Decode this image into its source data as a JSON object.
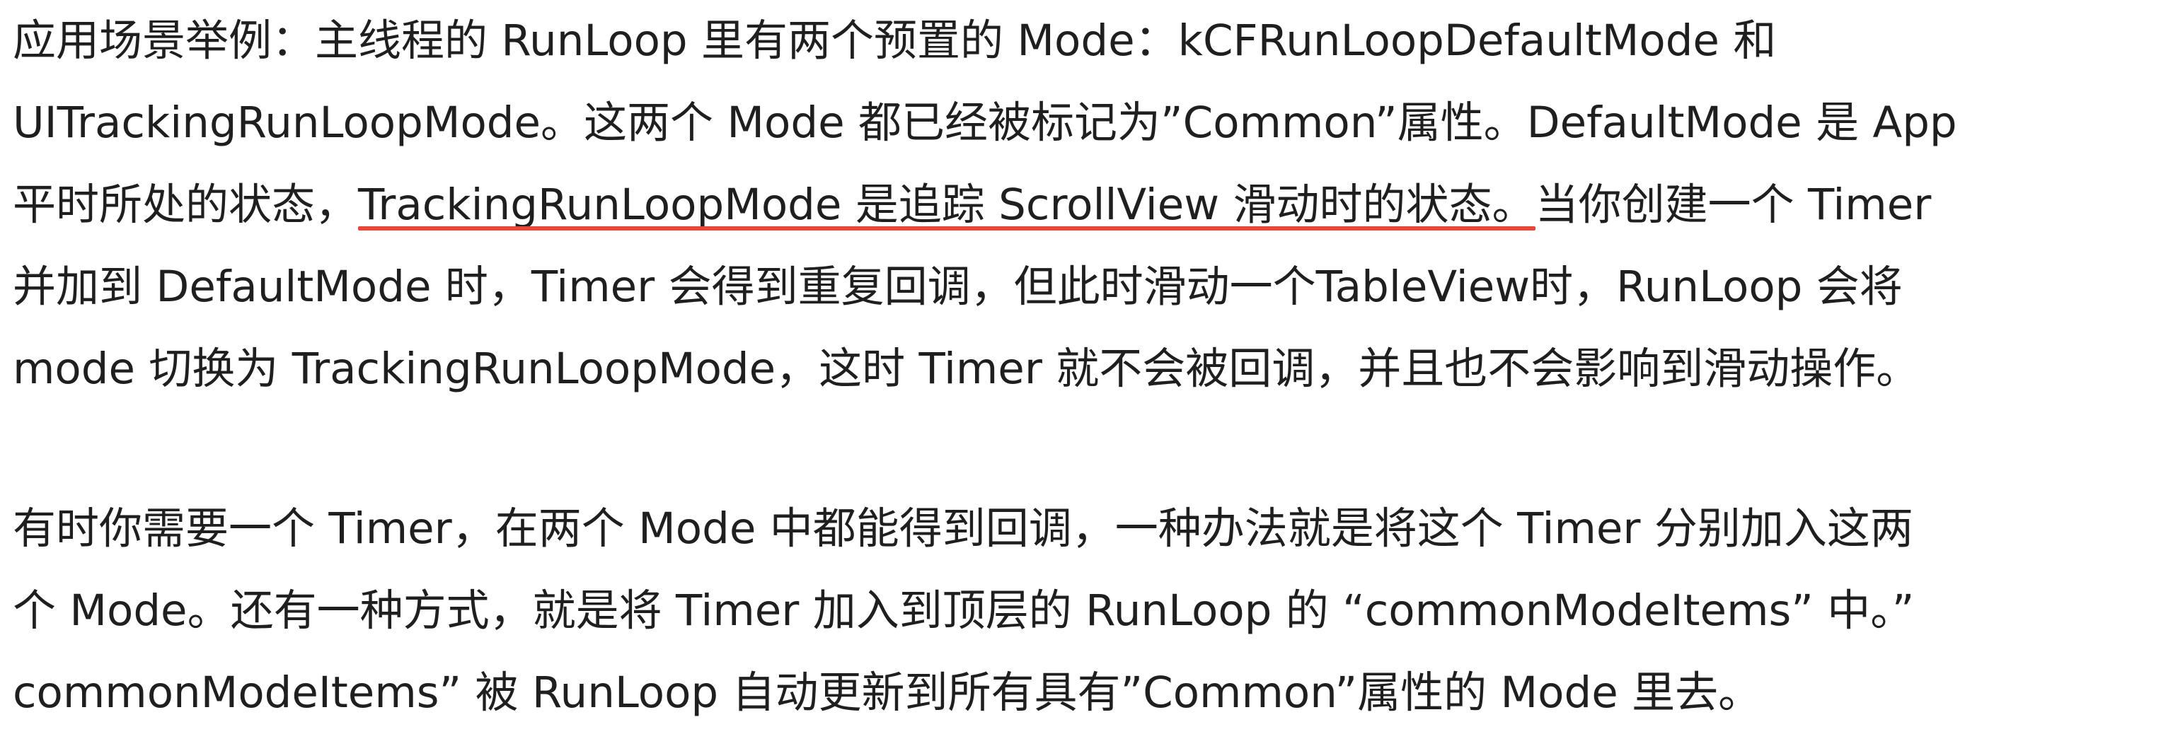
{
  "paragraphs": [
    {
      "lines": [
        {
          "text": "应用场景举例：主线程的 RunLoop 里有两个预置的 Mode：kCFRunLoopDefaultMode 和"
        },
        {
          "text": "UITrackingRunLoopMode。这两个 Mode 都已经被标记为”Common”属性。DefaultMode 是 App"
        },
        {
          "before": "平时所处的状态，",
          "highlight": "TrackingRunLoopMode 是追踪 ScrollView 滑动时的状态。",
          "after": "当你创建一个 Timer"
        },
        {
          "text": "并加到 DefaultMode 时，Timer 会得到重复回调，但此时滑动一个TableView时，RunLoop 会将"
        },
        {
          "text": "mode 切换为 TrackingRunLoopMode，这时 Timer 就不会被回调，并且也不会影响到滑动操作。"
        }
      ]
    },
    {
      "lines": [
        {
          "text": "有时你需要一个 Timer，在两个 Mode 中都能得到回调，一种办法就是将这个 Timer 分别加入这两"
        },
        {
          "text": "个 Mode。还有一种方式，就是将 Timer 加入到顶层的 RunLoop 的 “commonModeItems” 中。”"
        },
        {
          "text": "commonModeItems” 被 RunLoop 自动更新到所有具有”Common”属性的 Mode 里去。"
        }
      ]
    }
  ],
  "colors": {
    "text": "#1f1f1f",
    "underline": "#e8483a",
    "background": "#ffffff"
  }
}
